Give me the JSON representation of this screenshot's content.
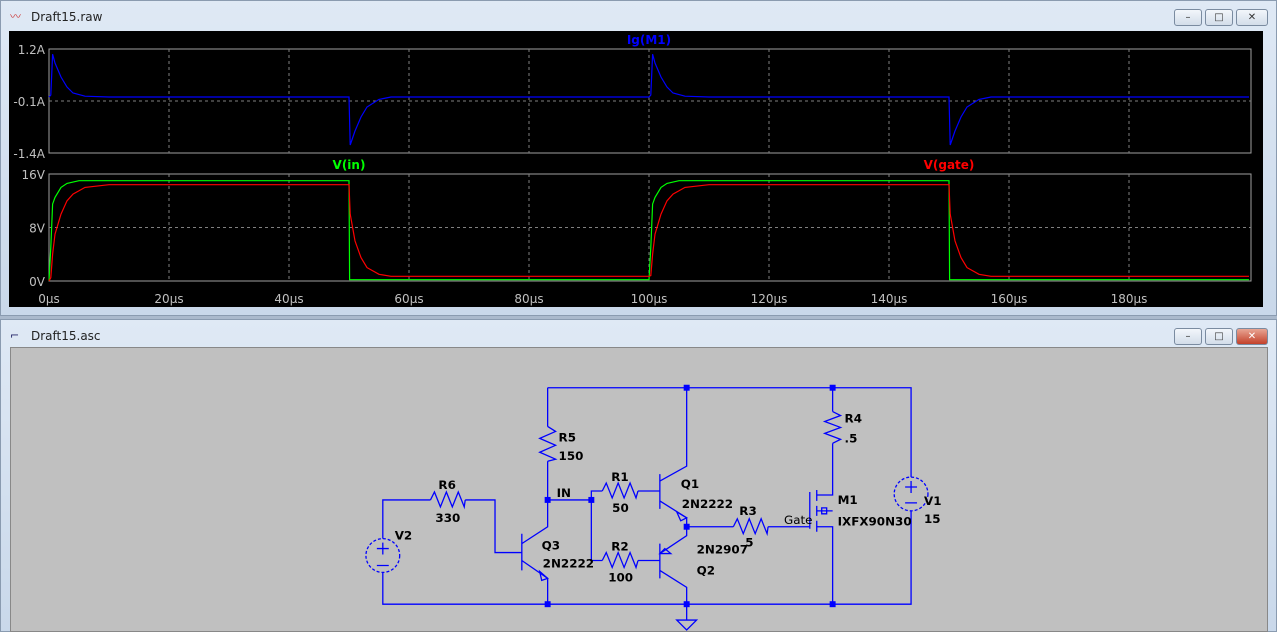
{
  "plot_window": {
    "title": "Draft15.raw",
    "minimize": "–",
    "restore": "□",
    "close": "✕",
    "icon": "waveform-icon"
  },
  "schematic_window": {
    "title": "Draft15.asc",
    "minimize": "–",
    "restore": "□",
    "close": "✕",
    "icon": "schematic-icon"
  },
  "chart_data": [
    {
      "type": "line",
      "title": "",
      "ylabel": "",
      "xlabel": "",
      "yticks": [
        "1.2A",
        "-0.1A",
        "-1.4A"
      ],
      "ylim": [
        -1.4,
        1.2
      ],
      "grid": true,
      "xlim": [
        0,
        200
      ],
      "series": [
        {
          "name": "Ig(M1)",
          "color": "#0000ff",
          "x": [
            0,
            0.3,
            0.6,
            1,
            2,
            3,
            4,
            6,
            10,
            50,
            50.2,
            51,
            52,
            53,
            55,
            57,
            100,
            100.3,
            100.6,
            101,
            102,
            103,
            104,
            106,
            110,
            150,
            150.2,
            151,
            152,
            153,
            155,
            157,
            200
          ],
          "y": [
            0,
            0.05,
            1.07,
            0.85,
            0.5,
            0.25,
            0.1,
            0.02,
            0,
            0,
            -1.2,
            -0.85,
            -0.5,
            -0.25,
            -0.06,
            0,
            0,
            0.05,
            1.07,
            0.85,
            0.5,
            0.25,
            0.1,
            0.02,
            0,
            0,
            -1.2,
            -0.85,
            -0.5,
            -0.25,
            -0.06,
            0,
            0
          ]
        }
      ]
    },
    {
      "type": "line",
      "title": "",
      "ylabel": "",
      "xlabel": "",
      "yticks": [
        "16V",
        "8V",
        "0V"
      ],
      "ylim": [
        0,
        16
      ],
      "grid": true,
      "xlim": [
        0,
        200
      ],
      "xticks": [
        "0µs",
        "20µs",
        "40µs",
        "60µs",
        "80µs",
        "100µs",
        "120µs",
        "140µs",
        "160µs",
        "180µs"
      ],
      "series": [
        {
          "name": "V(in)",
          "color": "#00ff00",
          "x": [
            0,
            0.3,
            0.6,
            1,
            2,
            3,
            5,
            50,
            50.1,
            100,
            100.3,
            100.6,
            101,
            102,
            103,
            105,
            150,
            150.1,
            200
          ],
          "y": [
            0,
            5,
            11.5,
            12.5,
            14,
            14.6,
            15,
            15,
            0.2,
            0.2,
            5,
            11.5,
            12.5,
            14,
            14.6,
            15,
            15,
            0.2,
            0.2
          ]
        },
        {
          "name": "V(gate)",
          "color": "#ff0000",
          "x": [
            0,
            0.3,
            0.6,
            1,
            2,
            3,
            4,
            6,
            10,
            50,
            50.2,
            51,
            52,
            53,
            55,
            57,
            100,
            100.3,
            100.6,
            101,
            102,
            103,
            104,
            106,
            110,
            150,
            150.2,
            151,
            152,
            153,
            155,
            157,
            200
          ],
          "y": [
            0,
            0.5,
            4,
            7,
            10,
            12,
            13,
            14,
            14.4,
            14.4,
            10,
            6,
            3.5,
            2,
            1,
            0.7,
            0.7,
            0.8,
            4,
            7,
            10,
            12,
            13,
            14,
            14.4,
            14.4,
            10,
            6,
            3.5,
            2,
            1,
            0.7,
            0.7
          ]
        }
      ]
    }
  ],
  "schematic": {
    "R5": {
      "name": "R5",
      "value": "150"
    },
    "R1": {
      "name": "R1",
      "value": "50"
    },
    "R2": {
      "name": "R2",
      "value": "100"
    },
    "R3": {
      "name": "R3",
      "value": "5"
    },
    "R4": {
      "name": "R4",
      "value": ".5"
    },
    "R6": {
      "name": "R6",
      "value": "330"
    },
    "Q1": {
      "name": "Q1",
      "model": "2N2222"
    },
    "Q2": {
      "name": "Q2",
      "model": "2N2907"
    },
    "Q3": {
      "name": "Q3",
      "model": "2N2222"
    },
    "M1": {
      "name": "M1",
      "model": "IXFX90N30"
    },
    "V1": {
      "name": "V1",
      "value": "15"
    },
    "V2": {
      "name": "V2"
    },
    "net_in": "IN",
    "net_gate": "Gate",
    "wire_color": "#0000ff",
    "label_color": "#000000"
  }
}
